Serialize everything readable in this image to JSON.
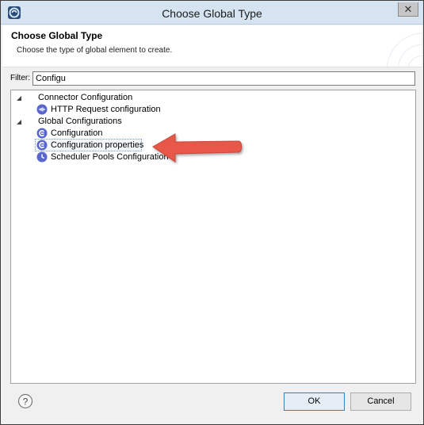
{
  "window": {
    "title": "Choose Global Type",
    "close_glyph": "✕"
  },
  "header": {
    "title": "Choose Global Type",
    "description": "Choose the type of global element to create."
  },
  "filter": {
    "label": "Filter:",
    "value": "Configu"
  },
  "tree": {
    "groups": [
      {
        "label": "Connector Configuration",
        "expanded": true,
        "items": [
          {
            "label": "HTTP Request configuration",
            "icon": "http-connector-icon"
          }
        ]
      },
      {
        "label": "Global Configurations",
        "expanded": true,
        "items": [
          {
            "label": "Configuration",
            "icon": "global-config-icon"
          },
          {
            "label": "Configuration properties",
            "icon": "global-config-icon",
            "selected": true
          },
          {
            "label": "Scheduler Pools Configuration",
            "icon": "clock-icon"
          }
        ]
      }
    ]
  },
  "footer": {
    "ok_label": "OK",
    "cancel_label": "Cancel",
    "help_glyph": "?"
  },
  "colors": {
    "icon_blue": "#5a66cc",
    "arrow_red": "#e8584a"
  }
}
